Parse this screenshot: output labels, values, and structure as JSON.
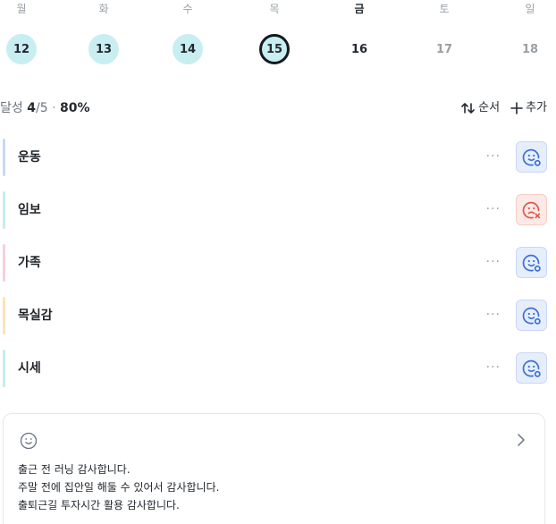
{
  "week": {
    "days": [
      {
        "name": "월",
        "date": "12",
        "state": "done"
      },
      {
        "name": "화",
        "date": "13",
        "state": "done"
      },
      {
        "name": "수",
        "date": "14",
        "state": "done"
      },
      {
        "name": "목",
        "date": "15",
        "state": "today"
      },
      {
        "name": "금",
        "date": "16",
        "state": "selected"
      },
      {
        "name": "토",
        "date": "17",
        "state": "future"
      },
      {
        "name": "일",
        "date": "18",
        "state": "future"
      }
    ]
  },
  "status": {
    "label": "달성",
    "done": "4",
    "slash": "/",
    "total": "5",
    "dot": "·",
    "percent": "80%",
    "order_label": "순서",
    "add_label": "추가"
  },
  "habits": [
    {
      "name": "운동",
      "bar_color": "#c9d9f4",
      "mood": "ok"
    },
    {
      "name": "임보",
      "bar_color": "#c6ecef",
      "mood": "bad"
    },
    {
      "name": "가족",
      "bar_color": "#f7cfe0",
      "mood": "ok"
    },
    {
      "name": "목실감",
      "bar_color": "#fde2b8",
      "mood": "ok"
    },
    {
      "name": "시세",
      "bar_color": "#c6ecef",
      "mood": "ok"
    }
  ],
  "more_label": "···",
  "colors": {
    "accent_blue": "#3b6fd8",
    "accent_red": "#e0574a",
    "done_circle": "#c8eef1"
  },
  "gratitude": {
    "lines": [
      "출근 전 러닝 감사합니다.",
      "주말 전에 집안일 해둘 수 있어서 감사합니다.",
      "출퇴근길 투자시간 활용 감사합니다."
    ]
  }
}
